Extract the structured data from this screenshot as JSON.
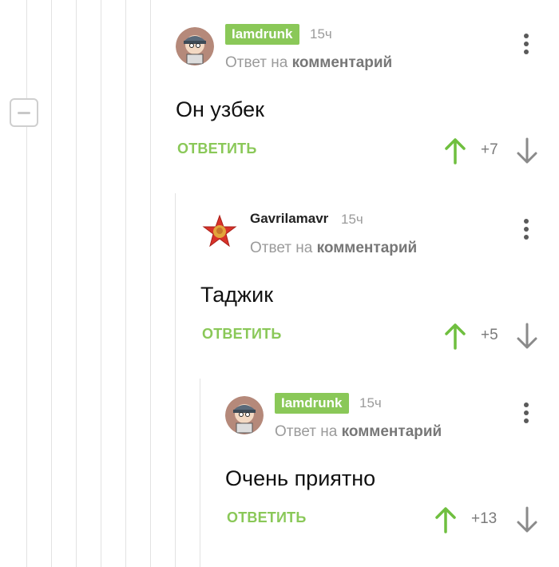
{
  "comments": [
    {
      "author": "Iamdrunk",
      "author_style": "badge",
      "avatar": "cartman-avatar",
      "time": "15ч",
      "reply_prefix": "Ответ на",
      "reply_link": "комментарий",
      "text": "Он узбек",
      "reply_label": "ОТВЕТИТЬ",
      "score": "+7"
    },
    {
      "author": "Gavrilamavr",
      "author_style": "plain",
      "avatar": "red-star-avatar",
      "time": "15ч",
      "reply_prefix": "Ответ на",
      "reply_link": "комментарий",
      "text": "Таджик",
      "reply_label": "ОТВЕТИТЬ",
      "score": "+5"
    },
    {
      "author": "Iamdrunk",
      "author_style": "badge",
      "avatar": "cartman-avatar",
      "time": "15ч",
      "reply_prefix": "Ответ на",
      "reply_link": "комментарий",
      "text": "Очень приятно",
      "reply_label": "ОТВЕТИТЬ",
      "score": "+13"
    }
  ],
  "colors": {
    "accent": "#8ac858",
    "upvote": "#6fbf3f",
    "muted": "#9b9b9b",
    "thread_line": "#e2e2e2"
  }
}
